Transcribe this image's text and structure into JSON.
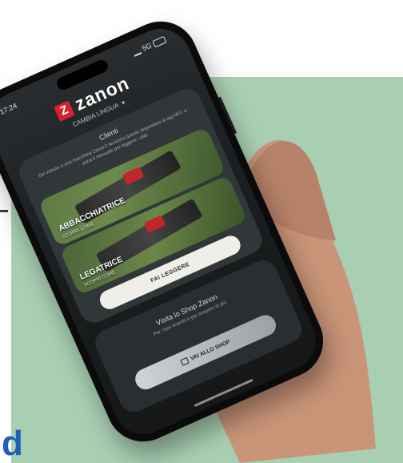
{
  "status": {
    "time": "17:24",
    "network": "5G"
  },
  "brand": {
    "mark": "Z",
    "name": "zanon"
  },
  "language": {
    "label": "CAMBIA LINGUA",
    "arrow": "▼"
  },
  "clients_card": {
    "title": "Clienti",
    "description": "Sei venuto a una macchina Zanon? Avvicina questo dispositivo al tag NFC e avrai il manuale per leggere i dati.",
    "products": [
      {
        "name": "ABBACCHIATRICE",
        "subtitle": "SCOPRI COME"
      },
      {
        "name": "LEGATRICE",
        "subtitle": "SCOPRI COME"
      }
    ],
    "cta_label": "FAI LEGGERE"
  },
  "shop_card": {
    "title": "Visita lo Shop Zanon",
    "description": "Per i tuoi ricambi è per scoprire di più.",
    "cta_label": "VAI ALLO SHOP"
  },
  "corner_letter": "d",
  "colors": {
    "panel": "#a9cfb3",
    "brand_red": "#d8232a",
    "accent_blue": "#1f5fb8"
  }
}
